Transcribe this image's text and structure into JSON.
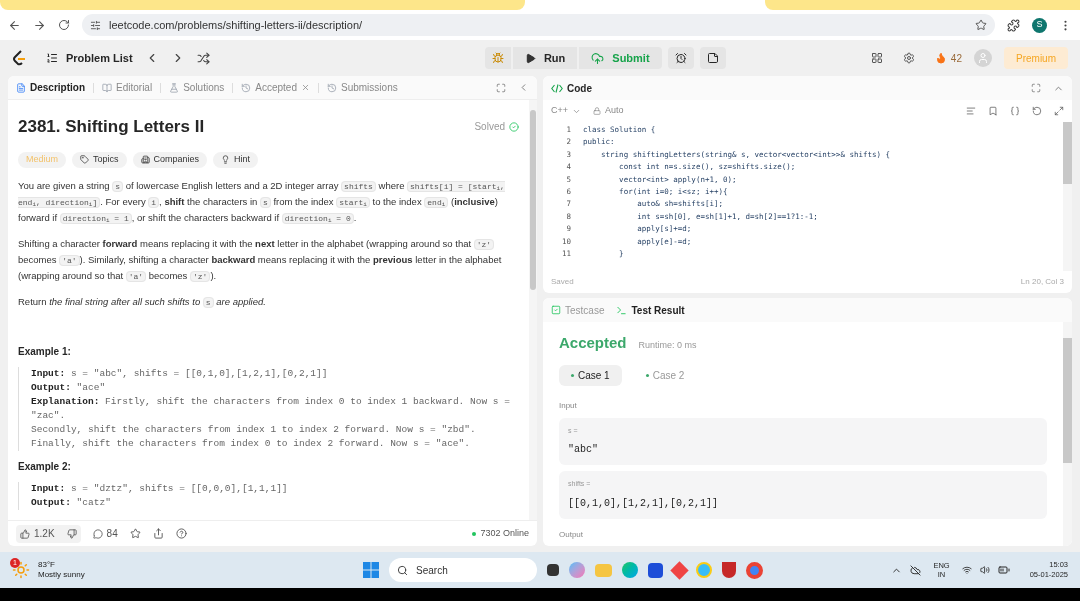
{
  "browser": {
    "url": "leetcode.com/problems/shifting-letters-ii/description/",
    "profile_initial": "S"
  },
  "nav": {
    "problem_list": "Problem List",
    "run": "Run",
    "submit": "Submit",
    "streak": "42",
    "premium": "Premium"
  },
  "left_tabs": [
    {
      "label": "Description",
      "selected": true,
      "closable": false
    },
    {
      "label": "Editorial",
      "selected": false,
      "closable": false
    },
    {
      "label": "Solutions",
      "selected": false,
      "closable": false
    },
    {
      "label": "Accepted",
      "selected": false,
      "closable": true
    },
    {
      "label": "Submissions",
      "selected": false,
      "closable": false
    }
  ],
  "problem": {
    "title": "2381. Shifting Letters II",
    "status": "Solved",
    "tags": [
      {
        "kind": "difficulty",
        "label": "Medium"
      },
      {
        "kind": "topics",
        "label": "Topics"
      },
      {
        "kind": "companies",
        "label": "Companies"
      },
      {
        "kind": "hint",
        "label": "Hint"
      }
    ],
    "paragraphs": [
      [
        {
          "kind": "text",
          "text": "You are given a string "
        },
        {
          "kind": "code",
          "text": "s"
        },
        {
          "kind": "text",
          "text": " of lowercase English letters and a 2D integer array "
        },
        {
          "kind": "code",
          "text": "shifts"
        },
        {
          "kind": "text",
          "text": " where "
        },
        {
          "kind": "code",
          "text": "shifts[i] = [start$_{i}$, end$_{i}$, direction$_{i}$]"
        },
        {
          "kind": "text",
          "text": ". For every "
        },
        {
          "kind": "code",
          "text": "i"
        },
        {
          "kind": "text",
          "text": ", **shift** the characters in "
        },
        {
          "kind": "code",
          "text": "s"
        },
        {
          "kind": "text",
          "text": " from the index "
        },
        {
          "kind": "code",
          "text": "start$_{i}$"
        },
        {
          "kind": "text",
          "text": " to the index "
        },
        {
          "kind": "code",
          "text": "end$_{i}$"
        },
        {
          "kind": "text",
          "text": " (**inclusive**) forward if "
        },
        {
          "kind": "code",
          "text": "direction$_{i}$ = 1"
        },
        {
          "kind": "text",
          "text": ", or shift the characters backward if "
        },
        {
          "kind": "code",
          "text": "direction$_{i}$ = 0"
        },
        {
          "kind": "text",
          "text": "."
        }
      ],
      [
        {
          "kind": "text",
          "text": "Shifting a character **forward** means replacing it with the **next** letter in the alphabet (wrapping around so that "
        },
        {
          "kind": "code",
          "text": "'z'"
        },
        {
          "kind": "text",
          "text": " becomes "
        },
        {
          "kind": "code",
          "text": "'a'"
        },
        {
          "kind": "text",
          "text": "). Similarly, shifting a character **backward** means replacing it with the **previous** letter in the alphabet (wrapping around so that "
        },
        {
          "kind": "code",
          "text": "'a'"
        },
        {
          "kind": "text",
          "text": " becomes "
        },
        {
          "kind": "code",
          "text": "'z'"
        },
        {
          "kind": "text",
          "text": ")."
        }
      ],
      [
        {
          "kind": "text",
          "text": "Return *the final string after all such shifts to* "
        },
        {
          "kind": "code",
          "text": "s"
        },
        {
          "kind": "text",
          "text": " *are applied.*"
        }
      ]
    ],
    "examples": [
      {
        "title": "Example 1:",
        "lines": [
          {
            "label": "Input:",
            "text": " s = \"abc\", shifts = [[0,1,0],[1,2,1],[0,2,1]]"
          },
          {
            "label": "Output:",
            "text": " \"ace\""
          },
          {
            "label": "Explanation:",
            "text": " Firstly, shift the characters from index 0 to index 1 backward. Now s = \"zac\"."
          },
          {
            "text": "Secondly, shift the characters from index 1 to index 2 forward. Now s = \"zbd\"."
          },
          {
            "text": "Finally, shift the characters from index 0 to index 2 forward. Now s = \"ace\"."
          }
        ]
      },
      {
        "title": "Example 2:",
        "lines": [
          {
            "label": "Input:",
            "text": " s = \"dztz\", shifts = [[0,0,0],[1,1,1]]"
          },
          {
            "label": "Output:",
            "text": " \"catz\""
          }
        ]
      }
    ]
  },
  "footer": {
    "likes": "1.2K",
    "comments": "84",
    "online": "7302 Online"
  },
  "code_panel": {
    "title": "Code",
    "language": "C++",
    "mode": "Auto",
    "status": "Saved",
    "cursor": "Ln 20, Col 3",
    "lines": [
      {
        "n": "1",
        "text": "class Solution {"
      },
      {
        "n": "2",
        "text": "public:"
      },
      {
        "n": "3",
        "text": "    string shiftingLetters(string& s, vector<vector<int>>& shifts) {"
      },
      {
        "n": "4",
        "text": "        const int n=s.size(), sz=shifts.size();"
      },
      {
        "n": "5",
        "text": "        vector<int> apply(n+1, 0);"
      },
      {
        "n": "6",
        "text": "        for(int i=0; i<sz; i++){"
      },
      {
        "n": "7",
        "text": "            auto& sh=shifts[i];"
      },
      {
        "n": "8",
        "text": "            int s=sh[0], e=sh[1]+1, d=sh[2]==1?1:-1;"
      },
      {
        "n": "9",
        "text": "            apply[s]+=d;"
      },
      {
        "n": "10",
        "text": "            apply[e]-=d;"
      },
      {
        "n": "11",
        "text": "        }"
      }
    ]
  },
  "test_tabs": [
    {
      "kind": "testcase",
      "label": "Testcase",
      "selected": false
    },
    {
      "kind": "result",
      "label": "Test Result",
      "selected": true
    }
  ],
  "result": {
    "verdict": "Accepted",
    "runtime": "Runtime: 0 ms",
    "cases": [
      {
        "label": "Case 1",
        "selected": true
      },
      {
        "label": "Case 2",
        "selected": false
      }
    ],
    "input_heading": "Input",
    "inputs": [
      {
        "name": "s =",
        "value": "\"abc\""
      },
      {
        "name": "shifts =",
        "value": "[[0,1,0],[1,2,1],[0,2,1]]"
      }
    ],
    "output_heading": "Output"
  },
  "taskbar": {
    "temperature": "83°F",
    "weather": "Mostly sunny",
    "notification_count": "1",
    "search": "Search",
    "language": "ENG",
    "region": "IN",
    "time": "15:03",
    "date": "05-01-2025"
  }
}
